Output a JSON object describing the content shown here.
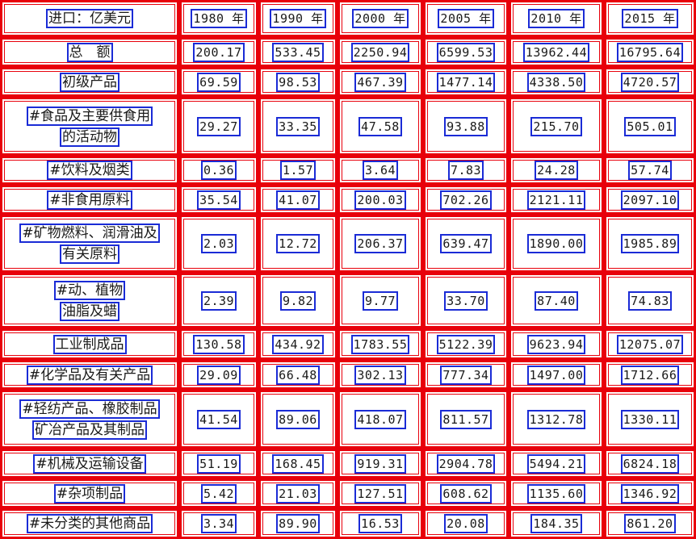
{
  "header": [
    "进口：亿美元",
    "1980 年",
    "1990 年",
    "2000 年",
    "2005 年",
    "2010 年",
    "2015 年"
  ],
  "rows": [
    {
      "label": [
        "总　额"
      ],
      "values": [
        "200.17",
        "533.45",
        "2250.94",
        "6599.53",
        "13962.44",
        "16795.64"
      ]
    },
    {
      "label": [
        "初级产品"
      ],
      "values": [
        "69.59",
        "98.53",
        "467.39",
        "1477.14",
        "4338.50",
        "4720.57"
      ]
    },
    {
      "label": [
        "#食品及主要供食用",
        "的活动物"
      ],
      "values": [
        "29.27",
        "33.35",
        "47.58",
        "93.88",
        "215.70",
        "505.01"
      ]
    },
    {
      "label": [
        "#饮料及烟类"
      ],
      "values": [
        "0.36",
        "1.57",
        "3.64",
        "7.83",
        "24.28",
        "57.74"
      ]
    },
    {
      "label": [
        "#非食用原料"
      ],
      "values": [
        "35.54",
        "41.07",
        "200.03",
        "702.26",
        "2121.11",
        "2097.10"
      ]
    },
    {
      "label": [
        "#矿物燃料、润滑油及",
        "有关原料"
      ],
      "values": [
        "2.03",
        "12.72",
        "206.37",
        "639.47",
        "1890.00",
        "1985.89"
      ]
    },
    {
      "label": [
        "#动、植物",
        "油脂及蜡"
      ],
      "values": [
        "2.39",
        "9.82",
        "9.77",
        "33.70",
        "87.40",
        "74.83"
      ]
    },
    {
      "label": [
        "工业制成品"
      ],
      "values": [
        "130.58",
        "434.92",
        "1783.55",
        "5122.39",
        "9623.94",
        "12075.07"
      ]
    },
    {
      "label": [
        "#化学品及有关产品"
      ],
      "values": [
        "29.09",
        "66.48",
        "302.13",
        "777.34",
        "1497.00",
        "1712.66"
      ]
    },
    {
      "label": [
        "#轻纺产品、橡胶制品",
        "矿冶产品及其制品"
      ],
      "values": [
        "41.54",
        "89.06",
        "418.07",
        "811.57",
        "1312.78",
        "1330.11"
      ]
    },
    {
      "label": [
        "#机械及运输设备"
      ],
      "values": [
        "51.19",
        "168.45",
        "919.31",
        "2904.78",
        "5494.21",
        "6824.18"
      ]
    },
    {
      "label": [
        "#杂项制品"
      ],
      "values": [
        "5.42",
        "21.03",
        "127.51",
        "608.62",
        "1135.60",
        "1346.92"
      ]
    },
    {
      "label": [
        "#未分类的其他商品"
      ],
      "values": [
        "3.34",
        "89.90",
        "16.53",
        "20.08",
        "184.35",
        "861.20"
      ]
    }
  ]
}
